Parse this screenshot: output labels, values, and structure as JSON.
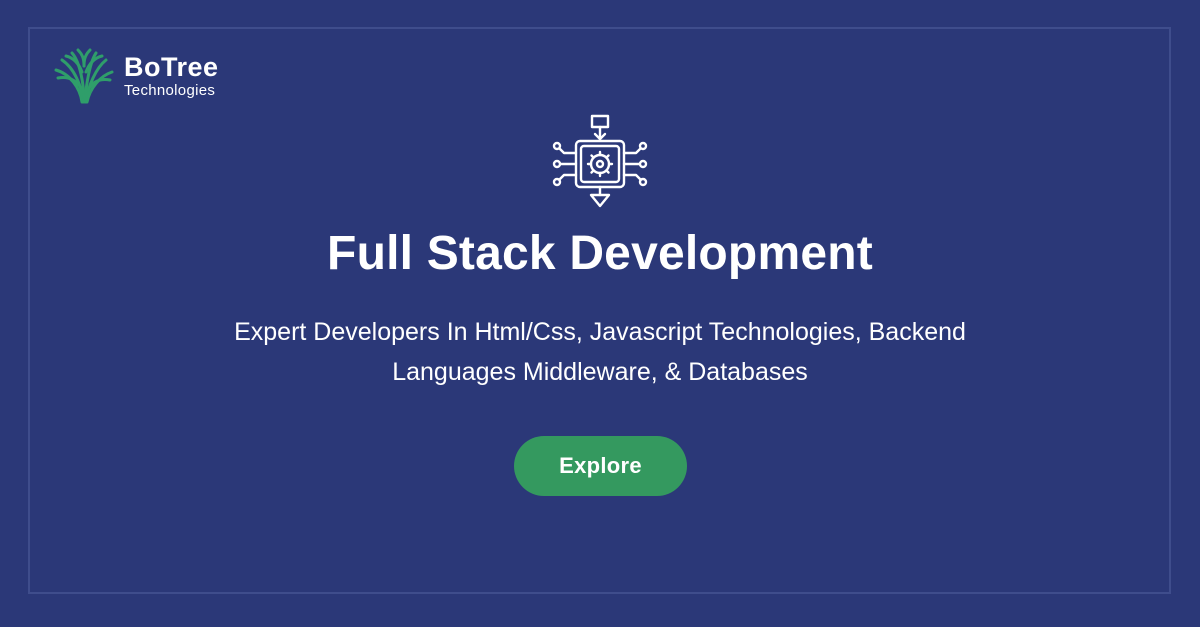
{
  "brand": {
    "name": "BoTree",
    "tagline": "Technologies"
  },
  "hero": {
    "icon": "full-stack-chip-icon",
    "title": "Full Stack Development",
    "subtitle_line1": "Expert Developers In Html/Css, Javascript Technologies, Backend",
    "subtitle_line2": "Languages Middleware, & Databases"
  },
  "cta": {
    "label": "Explore"
  },
  "colors": {
    "background": "#2b3878",
    "frame_border": "#3f4d8c",
    "logo_green": "#2f9e6a",
    "button_green": "#34995f",
    "text": "#ffffff"
  }
}
